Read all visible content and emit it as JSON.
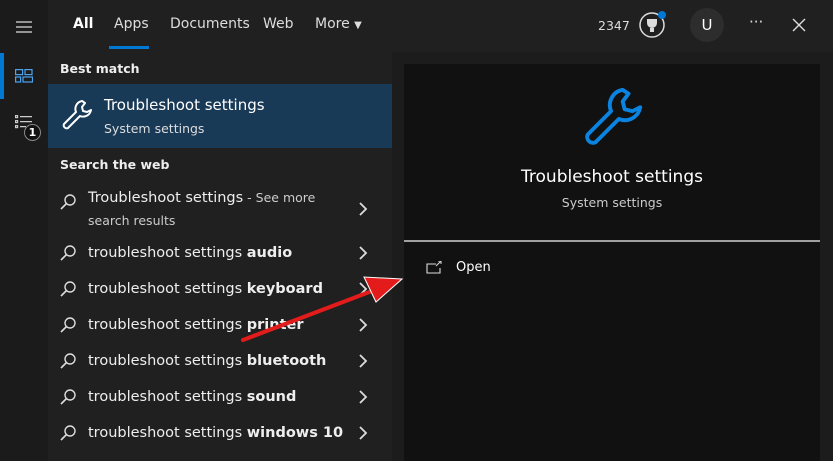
{
  "tabs": [
    {
      "label": "All"
    },
    {
      "label": "Apps"
    },
    {
      "label": "Documents"
    },
    {
      "label": "Web"
    },
    {
      "label": "More"
    }
  ],
  "points": "2347",
  "avatar_initial": "U",
  "more_options": "···",
  "sidebar": {
    "badge": "1"
  },
  "best_match": {
    "heading": "Best match",
    "title": "Troubleshoot settings",
    "subtitle": "System settings"
  },
  "web": {
    "heading": "Search the web",
    "first": {
      "query": "Troubleshoot settings",
      "suffix": " - See more",
      "line2": "search results"
    },
    "items": [
      {
        "prefix": "troubleshoot settings ",
        "bold": "audio"
      },
      {
        "prefix": "troubleshoot settings ",
        "bold": "keyboard"
      },
      {
        "prefix": "troubleshoot settings ",
        "bold": "printer"
      },
      {
        "prefix": "troubleshoot settings ",
        "bold": "bluetooth"
      },
      {
        "prefix": "troubleshoot settings ",
        "bold": "sound"
      },
      {
        "prefix": "troubleshoot settings ",
        "bold": "windows 10"
      }
    ]
  },
  "preview": {
    "title": "Troubleshoot settings",
    "subtitle": "System settings",
    "open_label": "Open"
  },
  "colors": {
    "accent": "#0078d4",
    "selected": "#193a57",
    "annotation": "#e31b1b"
  }
}
